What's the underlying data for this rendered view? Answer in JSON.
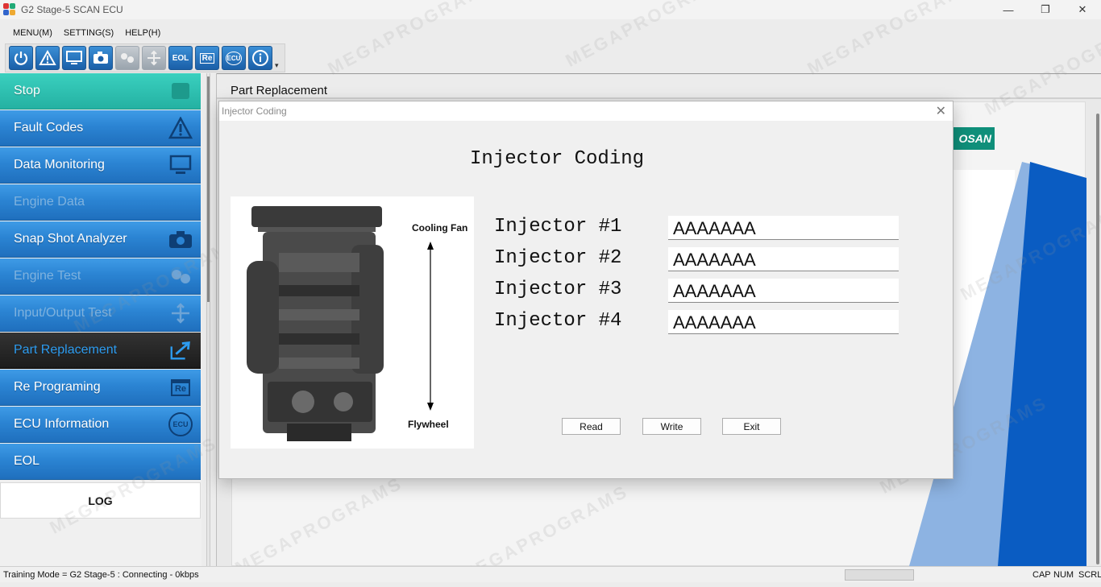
{
  "window": {
    "title": "G2 Stage-5 SCAN ECU",
    "minimize": "—",
    "restore": "❐",
    "close": "✕"
  },
  "menu": {
    "items": [
      "MENU(M)",
      "SETTING(S)",
      "HELP(H)"
    ]
  },
  "toolbar": {
    "eol_label": "EOL",
    "re_label": "Re",
    "ecu_label": "ECU",
    "grip": "▾"
  },
  "sidebar": {
    "items": [
      {
        "label": "Stop",
        "state": "stop",
        "icon": "stop-square-icon"
      },
      {
        "label": "Fault Codes",
        "state": "enabled",
        "icon": "warning-icon"
      },
      {
        "label": "Data Monitoring",
        "state": "enabled",
        "icon": "monitor-icon"
      },
      {
        "label": "Engine Data",
        "state": "disabled",
        "icon": ""
      },
      {
        "label": "Snap Shot Analyzer",
        "state": "enabled",
        "icon": "camera-icon"
      },
      {
        "label": "Engine Test",
        "state": "disabled",
        "icon": "engine-test-icon"
      },
      {
        "label": "Input/Output Test",
        "state": "disabled",
        "icon": "io-arrows-icon"
      },
      {
        "label": "Part Replacement",
        "state": "active",
        "icon": "part-replace-icon"
      },
      {
        "label": "Re Programing",
        "state": "enabled",
        "icon": "reprogram-icon"
      },
      {
        "label": "ECU Information",
        "state": "enabled",
        "icon": "ecu-icon"
      },
      {
        "label": "EOL",
        "state": "enabled",
        "icon": ""
      },
      {
        "label": "LOG",
        "state": "log",
        "icon": ""
      }
    ],
    "re_icon_text": "Re",
    "ecu_icon_text": "ECU"
  },
  "main": {
    "header": "Part Replacement",
    "brand": "OSAN"
  },
  "dialog": {
    "title": "Injector Coding",
    "close": "✕",
    "heading": "Injector Coding",
    "diagram": {
      "top_label": "Cooling Fan",
      "bottom_label": "Flywheel"
    },
    "injectors": [
      {
        "label": "Injector #1",
        "value": "AAAAAAA"
      },
      {
        "label": "Injector #2",
        "value": "AAAAAAA"
      },
      {
        "label": "Injector #3",
        "value": "AAAAAAA"
      },
      {
        "label": "Injector #4",
        "value": "AAAAAAA"
      }
    ],
    "buttons": {
      "read": "Read",
      "write": "Write",
      "exit": "Exit"
    }
  },
  "watermark": "MEGAPROGRAMS",
  "statusbar": {
    "text": "Training Mode = G2 Stage-5 : Connecting - 0kbps",
    "cap": "CAP",
    "num": "NUM",
    "scrl": "SCRL"
  },
  "colors": {
    "accent": "#2b84d3",
    "stop": "#24b1a2",
    "active_text": "#2d9cf0",
    "brand_blue": "#0a5cc2"
  }
}
